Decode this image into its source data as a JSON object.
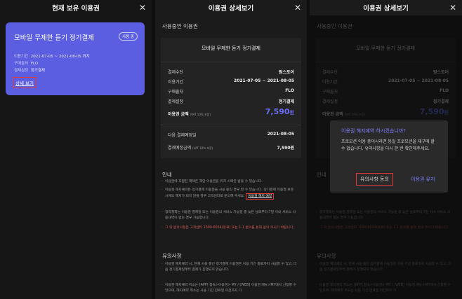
{
  "panel1": {
    "title": "현재 보유 이용권",
    "card": {
      "product": "모바일 무제한 듣기 정기결제",
      "badge": "사용 중",
      "period_label": "이용기간",
      "period_value": "2021-07-05 ~ 2021-08-05 까지",
      "purchase_label": "구매출처",
      "purchase_value": "FLO",
      "method_label": "결제설정",
      "method_value": "정기결제",
      "detail_link": "상세 보기"
    }
  },
  "panel2": {
    "title": "이용권 상세보기",
    "using_title": "사용중인 이용권",
    "product": "모바일 무제한 듣기 정기결제",
    "rows": {
      "pay_method": {
        "k": "결제수단",
        "v": "원스토어"
      },
      "period": {
        "k": "이용기간",
        "v": "2021-07-05 ~ 2021-08-05"
      },
      "source": {
        "k": "구매출처",
        "v": "FLO"
      },
      "setting": {
        "k": "결제설정",
        "v": "정기결제"
      },
      "amount_k": "이용권 금액",
      "amount_note": "(VAT 10% 포함)",
      "amount_v": "7,590",
      "amount_unit": "원",
      "next_k": "다음 결제예정일",
      "next_v": "2021-08-05",
      "next_amount_k": "결제예정금액",
      "next_amount_note": "(VAT 10% 포함)",
      "next_amount_v": "7,590원"
    },
    "guide_title": "안내",
    "guide": {
      "n1": "이용권에 포함된 혜택은 해당 이용권을 유지 시에만 받을 수 있습니다.",
      "n2": "이용권 해지예약은 정기결제 이용권을 사용 중인 경우 할 수 있습니다. 정기결제 이용권 보유 시에도 해지가 되지 않을 경우 고객센터로 문의해 주세요.",
      "link": "이용권 해지 예약",
      "n3": "청약철회는 이용권 결제일 또는 이용권의 서비스 가능일 중 늦은 날로부터 7일 이내 서비스 사용내역이 없는 경우 가능합니다.",
      "n4": "그 외 문의사항은 고객센터 1599-6034(유료) 또는 1:1 문의를 통해 문의 주시기 바랍니다."
    },
    "caution_title": "유의사항",
    "caution": {
      "c1": "이용권 해지예약 시, 현재 사용 중인 정기결제 이용권은 이용 기간 종료까지 사용할 수 있고, 다음 정기결제일부터 결제가 진행되지 않습니다.",
      "c2": "이용권 해지예약 취소는 [APP] 접속>이용권> MY / [WEB] 이용권 메뉴>MY에서 신청할 수 있으며, 해지예약 취소는 사용 기간 만료일 이전까지 가"
    }
  },
  "panel3": {
    "title": "이용권 상세보기",
    "dialog": {
      "question": "이용권 해지예약 하시겠습니까?",
      "message": "프로모션 이용 중이시라면 동일 프로모션을 재구매 할 수 없습니다. 유의사항을 다시 한 번 확인해주세요.",
      "agree": "유의사항 동의",
      "keep": "이용권 유지"
    }
  },
  "icons": {
    "close": "close-icon"
  },
  "colors": {
    "accent": "#5b5ee0",
    "price": "#6b6ef6",
    "highlight": "#e23b3b"
  }
}
